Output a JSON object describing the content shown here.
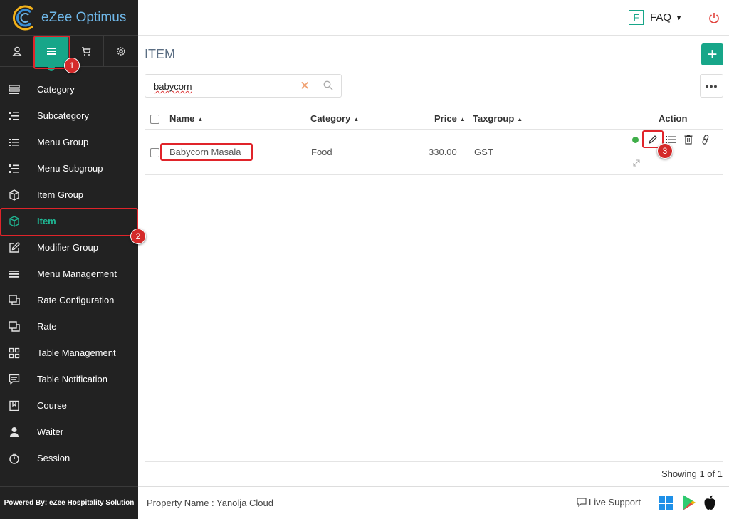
{
  "app": {
    "name": "eZee Optimus",
    "brand_color": "#17a689"
  },
  "sidebar": {
    "top_icons": [
      {
        "icon": "user-icon"
      },
      {
        "icon": "menu-icon",
        "active": true
      },
      {
        "icon": "cart-icon"
      },
      {
        "icon": "gear-icon"
      }
    ],
    "items": [
      {
        "label": "Category",
        "icon": "category-icon"
      },
      {
        "label": "Subcategory",
        "icon": "subcategory-icon"
      },
      {
        "label": "Menu Group",
        "icon": "list-icon"
      },
      {
        "label": "Menu Subgroup",
        "icon": "sublist-icon"
      },
      {
        "label": "Item Group",
        "icon": "cube-icon"
      },
      {
        "label": "Item",
        "icon": "cube-icon",
        "active": true
      },
      {
        "label": "Modifier Group",
        "icon": "edit-icon"
      },
      {
        "label": "Menu Management",
        "icon": "hamburger-icon"
      },
      {
        "label": "Rate Configuration",
        "icon": "copy-icon"
      },
      {
        "label": "Rate",
        "icon": "copy-icon"
      },
      {
        "label": "Table Management",
        "icon": "grid-icon"
      },
      {
        "label": "Table Notification",
        "icon": "chat-icon"
      },
      {
        "label": "Course",
        "icon": "bookmark-icon"
      },
      {
        "label": "Waiter",
        "icon": "person-icon"
      },
      {
        "label": "Session",
        "icon": "timer-icon"
      }
    ],
    "footer": "Powered By: eZee Hospitality Solution"
  },
  "header": {
    "faq_letter": "F",
    "faq_label": "FAQ"
  },
  "main": {
    "title": "ITEM",
    "add_label": "+",
    "more_label": "•••",
    "search": {
      "value": "babycorn"
    },
    "table": {
      "headers": {
        "name": "Name",
        "category": "Category",
        "price": "Price",
        "taxgroup": "Taxgroup",
        "action": "Action"
      },
      "rows": [
        {
          "name": "Babycorn Masala",
          "category": "Food",
          "price": "330.00",
          "taxgroup": "GST"
        }
      ]
    },
    "showing": "Showing 1 of 1"
  },
  "footer": {
    "property": "Property Name : Yanolja Cloud",
    "live_support": "Live Support"
  },
  "annotations": {
    "badge_1": "1",
    "badge_2": "2",
    "badge_3": "3"
  }
}
